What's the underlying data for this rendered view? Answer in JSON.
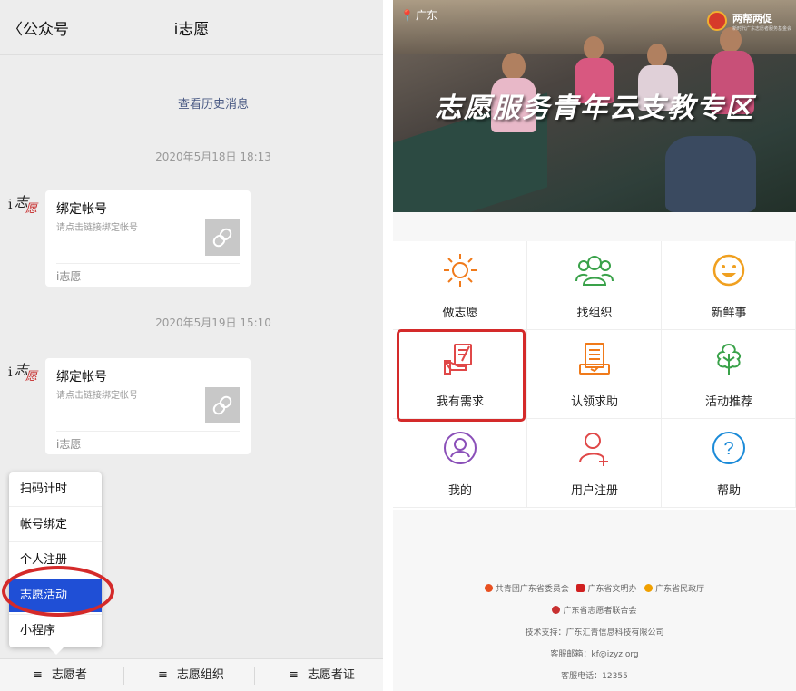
{
  "left": {
    "back_label": "公众号",
    "title": "i志愿",
    "history_link": "查看历史消息",
    "messages": [
      {
        "timestamp": "2020年5月18日 18:13",
        "card_title": "绑定帐号",
        "card_sub": "请点击链接绑定帐号",
        "card_footer": "i志愿"
      },
      {
        "timestamp": "2020年5月19日 15:10",
        "card_title": "绑定帐号",
        "card_sub": "请点击链接绑定帐号",
        "card_footer": "i志愿"
      }
    ],
    "popup_menu": [
      "扫码计时",
      "帐号绑定",
      "个人注册",
      "志愿活动",
      "小程序"
    ],
    "popup_active": "志愿活动",
    "bottom_menu": [
      "志愿者",
      "志愿组织",
      "志愿者证"
    ]
  },
  "right": {
    "location": "广东",
    "logo_text": "两帮两促",
    "logo_sub": "新时代广东志愿者服务基金会",
    "banner_title": "志愿服务青年云支教专区",
    "grid": [
      {
        "label": "做志愿",
        "icon": "sun-icon",
        "color": "#f07a1a"
      },
      {
        "label": "找组织",
        "icon": "group-icon",
        "color": "#3aa24a"
      },
      {
        "label": "新鲜事",
        "icon": "smile-icon",
        "color": "#f0a020"
      },
      {
        "label": "我有需求",
        "icon": "hand-request-icon",
        "color": "#e04848"
      },
      {
        "label": "认领求助",
        "icon": "document-icon",
        "color": "#f07a1a"
      },
      {
        "label": "活动推荐",
        "icon": "tree-icon",
        "color": "#3aa24a"
      },
      {
        "label": "我的",
        "icon": "user-circle-icon",
        "color": "#8a4fb8"
      },
      {
        "label": "用户注册",
        "icon": "user-add-icon",
        "color": "#e04848"
      },
      {
        "label": "帮助",
        "icon": "help-icon",
        "color": "#1a8ad8"
      }
    ],
    "footer": {
      "orgs": [
        "共青团广东省委员会",
        "广东省文明办",
        "广东省民政厅"
      ],
      "org2": "广东省志愿者联合会",
      "tech": "技术支持：广东汇青信息科技有限公司",
      "email": "客服邮箱：kf@izyz.org",
      "phone": "客服电话：12355"
    }
  }
}
